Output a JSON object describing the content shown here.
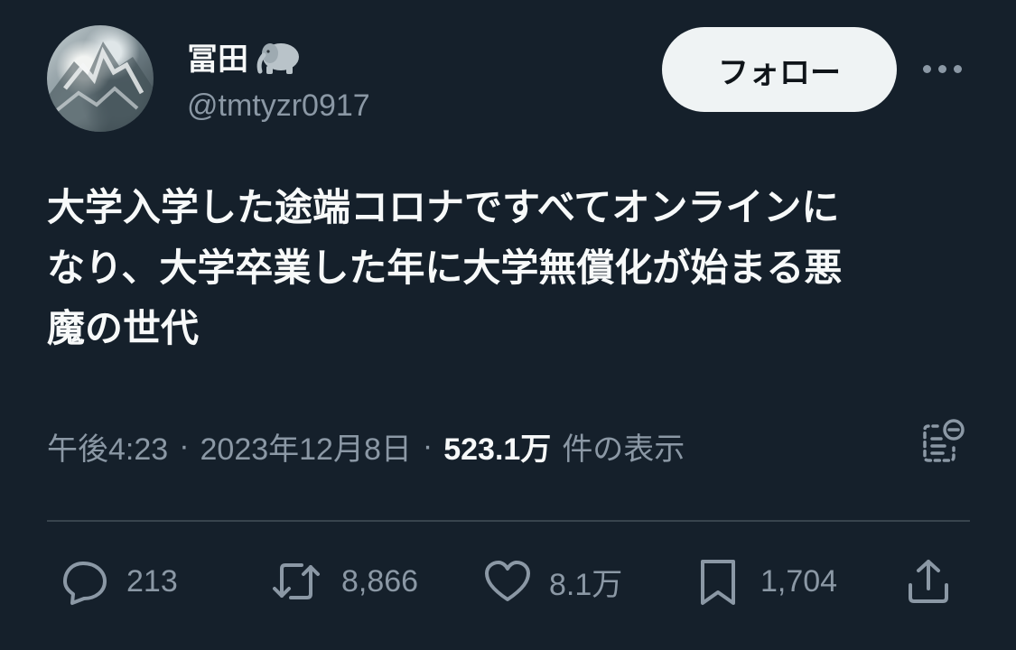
{
  "user": {
    "display_name": "冨田",
    "name_emoji_icon": "elephant-icon",
    "handle": "@tmtyzr0917"
  },
  "follow_button_label": "フォロー",
  "tweet": {
    "text": "大学入学した途端コロナですべてオンラインに\nなり、大学卒業した年に大学無償化が始まる悪\n魔の世代"
  },
  "meta": {
    "time": "午後4:23",
    "separator": "·",
    "date": "2023年12月8日",
    "views": "523.1万",
    "views_suffix": "件の表示"
  },
  "actions": {
    "replies": "213",
    "retweets": "8,866",
    "likes": "8.1万",
    "bookmarks": "1,704"
  },
  "colors": {
    "background": "#15202b",
    "text_primary": "#f7f9f9",
    "text_secondary": "#8b98a5",
    "button_bg": "#eff3f4"
  }
}
